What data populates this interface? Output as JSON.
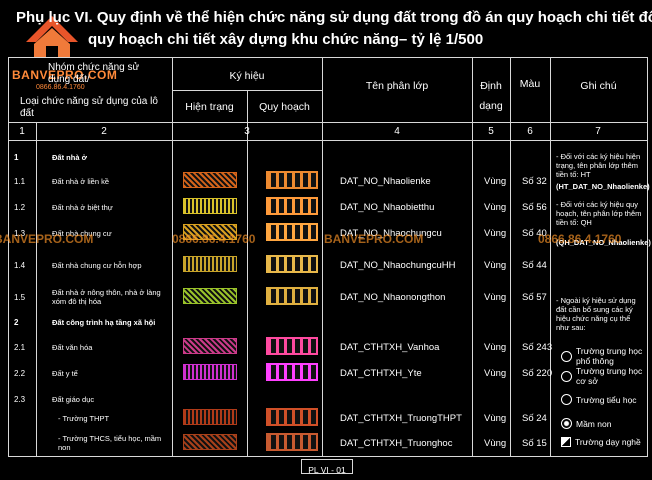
{
  "title_line1": "Phụ lục VI. Quy định về thể hiện chức năng sử dụng đất trong đồ án quy hoạch chi tiết đô thị,",
  "title_line2": "quy hoạch chi tiết xây dựng khu chức năng– tỷ lệ 1/500",
  "logo": {
    "name": "BANVEPRO.COM",
    "phone": "0866.86.4.1760"
  },
  "watermarks": {
    "site": "BANVEPRO.COM",
    "phone": "0866.86.4.1760"
  },
  "headers": {
    "group": "Nhóm chức năng sử dụng đất/",
    "type": "Loại chức năng sử dụng của lô đất",
    "symbol": "Ký hiệu",
    "current": "Hiện trạng",
    "plan": "Quy hoạch",
    "layer": "Tên phân lớp",
    "format": "Định dạng",
    "color": "Màu",
    "note": "Ghi chú"
  },
  "col_numbers": [
    "1",
    "2",
    "3",
    "4",
    "5",
    "6",
    "7"
  ],
  "rows": [
    {
      "id": "1",
      "label": "Đất nhà ở",
      "bold": true,
      "layer": "",
      "format": "",
      "color": ""
    },
    {
      "id": "1.1",
      "label": "Đất nhà ở liền kề",
      "layer": "DAT_NO_Nhaolienke",
      "format": "Vùng",
      "color": "Số 32",
      "c1": "#d5641a",
      "c2": "#ee8a30"
    },
    {
      "id": "1.2",
      "label": "Đất nhà ở biệt thự",
      "layer": "DAT_NO_Nhaobietthu",
      "format": "Vùng",
      "color": "Số 56",
      "c1": "#d9c22a",
      "c2": "#ff9a3a"
    },
    {
      "id": "1.3",
      "label": "Đất nhà chung cư",
      "layer": "DAT_NO_Nhaochungcu",
      "format": "Vùng",
      "color": "Số 40",
      "c1": "#d8a020",
      "c2": "#ffa640"
    },
    {
      "id": "1.4",
      "label": "Đất nhà chung cư hỗn hợp",
      "layer": "DAT_NO_NhaochungcuHH",
      "format": "Vùng",
      "color": "Số 44",
      "c1": "#c8a42a",
      "c2": "#e8b84a"
    },
    {
      "id": "1.5",
      "label": "Đất nhà ở nông thôn, nhà ở làng xóm đô thị hóa",
      "layer": "DAT_NO_Nhaonongthon",
      "format": "Vùng",
      "color": "Số 57",
      "c1": "#9ac32a",
      "c2": "#e0b040"
    },
    {
      "id": "2",
      "label": "Đất công trình hạ tầng xã hội",
      "bold": true,
      "layer": "",
      "format": "",
      "color": ""
    },
    {
      "id": "2.1",
      "label": "Đất văn hóa",
      "layer": "DAT_CTHTXH_Vanhoa",
      "format": "Vùng",
      "color": "Số 243",
      "c1": "#cc3a8a",
      "c2": "#ff4aa0"
    },
    {
      "id": "2.2",
      "label": "Đất y tế",
      "layer": "DAT_CTHTXH_Yte",
      "format": "Vùng",
      "color": "Số 220",
      "c1": "#d030d0",
      "c2": "#ff40ff"
    },
    {
      "id": "2.3",
      "label": "Đất giáo dục",
      "layer": "",
      "format": "",
      "color": ""
    },
    {
      "id": "",
      "label": "- Trường THPT",
      "layer": "DAT_CTHTXH_TruongTHPT",
      "format": "Vùng",
      "color": "Số 24",
      "c1": "#b03a18",
      "c2": "#d05028"
    },
    {
      "id": "",
      "label": "- Trường THCS, tiểu học, mầm non",
      "layer": "DAT_CTHTXH_Truonghoc",
      "format": "Vùng",
      "color": "Số 15",
      "c1": "#a8401a",
      "c2": "#c85a30"
    }
  ],
  "notes": {
    "note1": "- Đối với các ký hiệu hiện trạng, tên phân lớp thêm tiền tố: HT",
    "note1_code": "(HT_DAT_NO_Nhaolienke)",
    "note2": "- Đối với các ký hiệu quy hoạch, tên phân lớp thêm tiền tố: QH",
    "note2_code": "(QH_DAT_NO_Nhaolienke)",
    "note3": "- Ngoài ký hiệu sử dụng đất cần bổ sung các ký hiệu chức năng cụ thể như sau:"
  },
  "legend": [
    {
      "icon": "school-high-icon",
      "text": "Trường trung học phổ thông"
    },
    {
      "icon": "school-mid-icon",
      "text": "Trường trung học cơ sở"
    },
    {
      "icon": "school-primary-icon",
      "text": "Trường tiểu học"
    },
    {
      "icon": "kindergarten-icon",
      "text": "Mầm non"
    },
    {
      "icon": "vocational-icon",
      "text": "Trường dạy nghề"
    }
  ],
  "footer": "PL VI - 01"
}
